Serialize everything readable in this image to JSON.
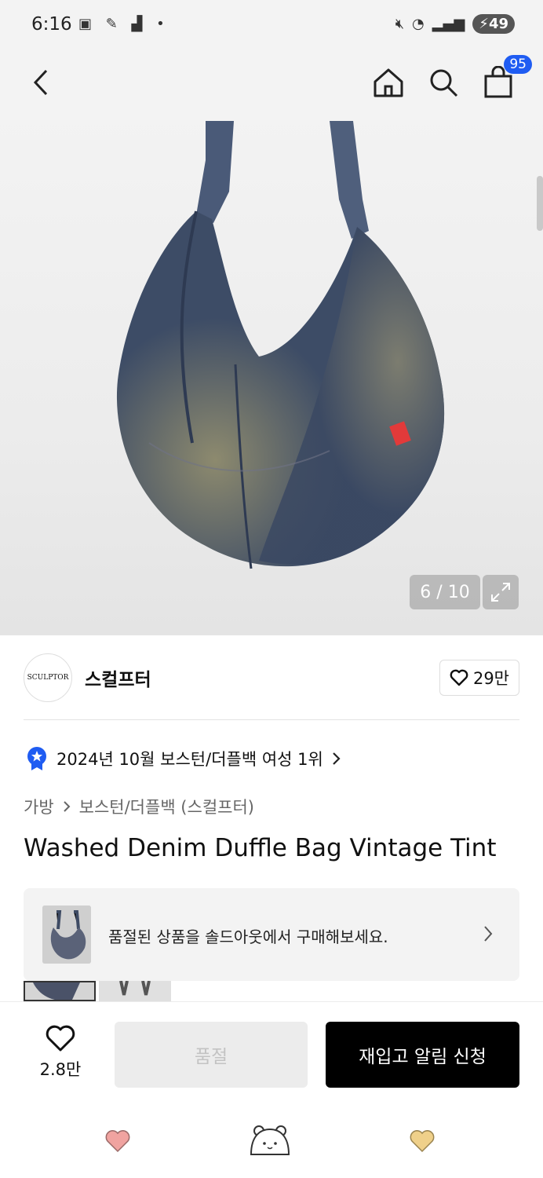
{
  "status_bar": {
    "time": "6:16",
    "battery": "49"
  },
  "top_bar": {
    "cart_count": "95"
  },
  "gallery": {
    "counter": "6 / 10"
  },
  "brand": {
    "name": "스컬프터",
    "logo_text": "SCULPTOR",
    "likes": "29만"
  },
  "ranking": {
    "text": "2024년 10월 보스턴/더플백 여성 1위"
  },
  "breadcrumb": {
    "level1": "가방",
    "level2": "보스턴/더플백 (스컬프터)"
  },
  "product": {
    "title": "Washed Denim Duffle Bag Vintage Tint"
  },
  "soldout_banner": {
    "text": "품절된 상품을 솔드아웃에서 구매해보세요."
  },
  "bottom_bar": {
    "wish_count": "2.8만",
    "sold_out_label": "품절",
    "restock_label": "재입고 알림 신청"
  },
  "colors": {
    "accent": "#1f5cf2",
    "primary_button": "#000000"
  }
}
